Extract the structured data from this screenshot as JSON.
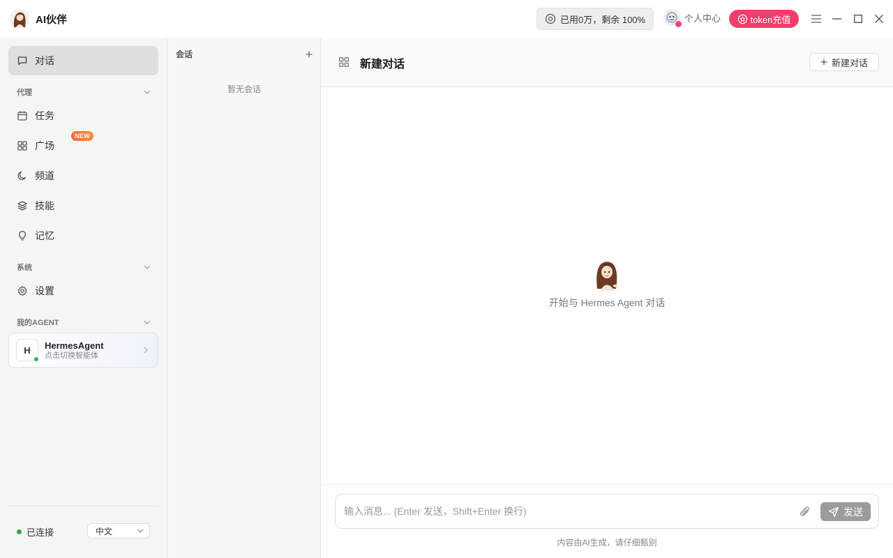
{
  "app": {
    "title": "AI伙伴"
  },
  "titlebar": {
    "usage_text": "已用0万，剩余 100%",
    "profile_label": "个人中心",
    "token_label": "token充值",
    "icons": [
      "menu-icon",
      "minimize-icon",
      "maximize-icon",
      "close-icon"
    ]
  },
  "sidebar": {
    "chat_label": "对话",
    "section_agent": "代理",
    "items": [
      {
        "label": "任务",
        "icon": "calendar-icon"
      },
      {
        "label": "广场",
        "icon": "grid-icon",
        "badge": "NEW"
      },
      {
        "label": "频道",
        "icon": "moon-icon"
      },
      {
        "label": "技能",
        "icon": "layers-icon"
      },
      {
        "label": "记忆",
        "icon": "lightbulb-icon"
      }
    ],
    "section_system": "系统",
    "settings_label": "设置",
    "section_my_agent": "我的AGENT",
    "agent": {
      "initial": "H",
      "name": "HermesAgent",
      "subtitle": "点击切换智能体"
    },
    "status": "已连接",
    "language": "中文"
  },
  "sessions": {
    "header": "会话",
    "empty": "暂无会话"
  },
  "main": {
    "title": "新建对话",
    "new_chat_label": "新建对话",
    "welcome_text": "开始与 Hermes Agent 对话",
    "input_placeholder": "输入消息... (Enter 发送，Shift+Enter 换行)",
    "input_value": "",
    "send_label": "发送",
    "disclaimer": "内容由AI生成，请仔细甄别"
  },
  "colors": {
    "accent_pink": "#f43d6a",
    "status_green": "#2fa84f",
    "new_badge": "#ff6a3d",
    "send_disabled": "#9c9c9c"
  }
}
